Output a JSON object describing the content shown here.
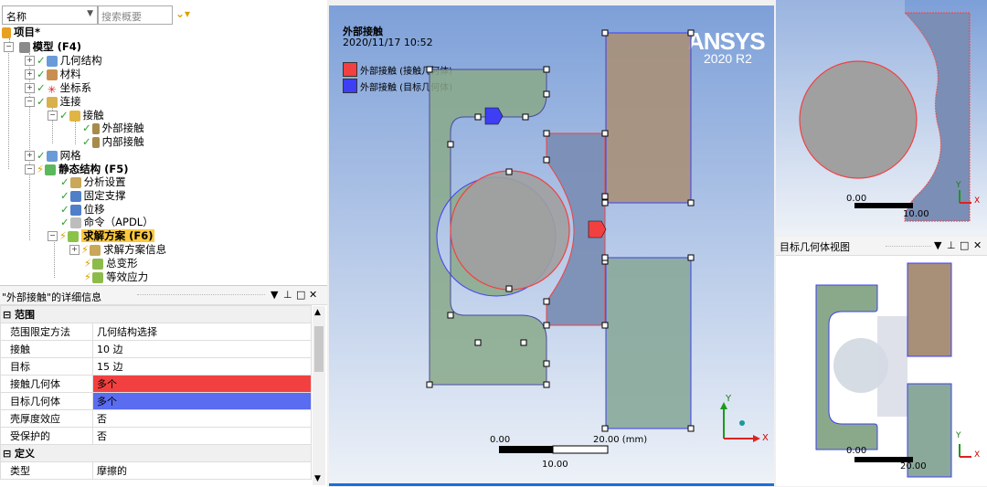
{
  "tree": {
    "name_label": "名称",
    "search_placeholder": "搜索概要",
    "nodes": {
      "project": "项目*",
      "model": "模型 (F4)",
      "geometry": "几何结构",
      "materials": "材料",
      "coord": "坐标系",
      "connections": "连接",
      "contacts": "接触",
      "contact_outer": "外部接触",
      "contact_inner": "内部接触",
      "mesh": "网格",
      "static": "静态结构 (F5)",
      "analysis_settings": "分析设置",
      "fixed_support": "固定支撑",
      "displacement": "位移",
      "command": "命令（APDL）",
      "solution": "求解方案 (F6)",
      "solution_info": "求解方案信息",
      "total_deformation": "总变形",
      "equiv_stress": "等效应力"
    }
  },
  "details": {
    "title": "\"外部接触\"的详细信息",
    "groups": {
      "scope": "范围",
      "definition": "定义"
    },
    "rows": [
      {
        "key": "范围限定方法",
        "value": "几何结构选择"
      },
      {
        "key": "接触",
        "value": "10 边"
      },
      {
        "key": "目标",
        "value": "15 边"
      },
      {
        "key": "接触几何体",
        "value": "多个"
      },
      {
        "key": "目标几何体",
        "value": "多个"
      },
      {
        "key": "壳厚度效应",
        "value": "否"
      },
      {
        "key": "受保护的",
        "value": "否"
      }
    ],
    "def_rows": [
      {
        "key": "类型",
        "value": "摩擦的"
      }
    ]
  },
  "viewport": {
    "title": "外部接触",
    "date": "2020/11/17 10:52",
    "legend_contact": "外部接触 (接触几何体)",
    "legend_target": "外部接触 (目标几何体)",
    "logo_main": "ANSYS",
    "logo_ver": "2020 R2",
    "scale_start": "0.00",
    "scale_end": "20.00 (mm)",
    "scale_mid": "10.00",
    "axis_x": "X",
    "axis_y": "Y"
  },
  "right_top": {
    "scale_start": "0.00",
    "scale_end": "10.00",
    "axis_x": "X",
    "axis_y": "Y"
  },
  "right_bottom": {
    "title": "目标几何体视图",
    "scale_start": "0.00",
    "scale_end": "20.00",
    "axis_x": "X",
    "axis_y": "Y"
  },
  "colors": {
    "contact": "#f24040",
    "target": "#3e3ef5",
    "selected": "#ffc83d"
  }
}
